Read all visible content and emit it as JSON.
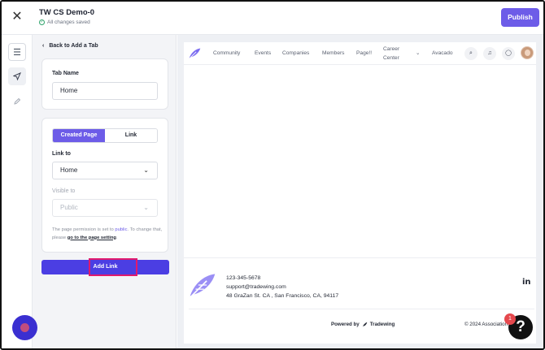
{
  "topbar": {
    "title": "TW CS Demo-0",
    "status": "All changes saved",
    "publish_label": "Publish",
    "close_icon": "✕"
  },
  "rail": {
    "icons": [
      "list-icon",
      "navigation-icon",
      "pencil-icon"
    ]
  },
  "panel": {
    "back_label": "Back to Add a Tab",
    "tab_name_label": "Tab Name",
    "tab_name_value": "Home",
    "segments": [
      "Created Page",
      "Link"
    ],
    "link_to_label": "Link to",
    "link_to_value": "Home",
    "visible_to_label": "Visible to",
    "visible_to_value": "Public",
    "help_prefix": "The page permission is set to ",
    "help_perm": "public",
    "help_mid": ". To change that, please ",
    "help_link": "go to the page setting",
    "help_end": ".",
    "add_link_label": "Add Link"
  },
  "site": {
    "nav": [
      "Community",
      "Events",
      "Companies",
      "Members",
      "Page!!"
    ],
    "nav_career_1": "Career",
    "nav_career_2": "Center",
    "nav_last": "Avacado",
    "footer": {
      "phone": "123-345-5678",
      "email": "support@tradewing.com",
      "address": "48 GraZan St. CA , San Francisco, CA, 94117",
      "linkedin": "in",
      "powered_label": "Powered by",
      "powered_brand": "Tradewing",
      "copyright": "© 2024 Association"
    }
  },
  "help_widget": {
    "badge": "1",
    "glyph": "?"
  },
  "colors": {
    "accent": "#6d5ce8",
    "add_link": "#4b3ee3",
    "highlight": "#e0196d"
  }
}
